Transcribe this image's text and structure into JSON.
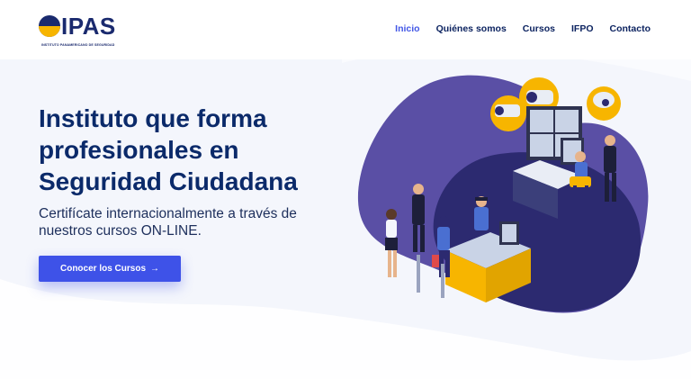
{
  "brand": {
    "name": "IPAS",
    "tagline": "INSTITUTO PANAMERICANO DE SEGURIDAD"
  },
  "nav": {
    "items": [
      {
        "label": "Inicio",
        "active": true
      },
      {
        "label": "Quiénes somos",
        "active": false
      },
      {
        "label": "Cursos",
        "active": false
      },
      {
        "label": "IFPO",
        "active": false
      },
      {
        "label": "Contacto",
        "active": false
      }
    ]
  },
  "hero": {
    "title": "Instituto que forma profesionales en Seguridad Ciudadana",
    "subtitle": "Certifícate internacionalmente a través de nuestros cursos ON-LINE.",
    "cta_label": "Conocer los Cursos",
    "cta_icon": "arrow-right-icon"
  },
  "colors": {
    "accent": "#3e52e8",
    "nav_active": "#4257e6",
    "heading": "#0b2a6a",
    "blob_purple": "#5a4fa5",
    "blob_dark": "#2c2a70",
    "logo_yellow": "#f7b500"
  }
}
